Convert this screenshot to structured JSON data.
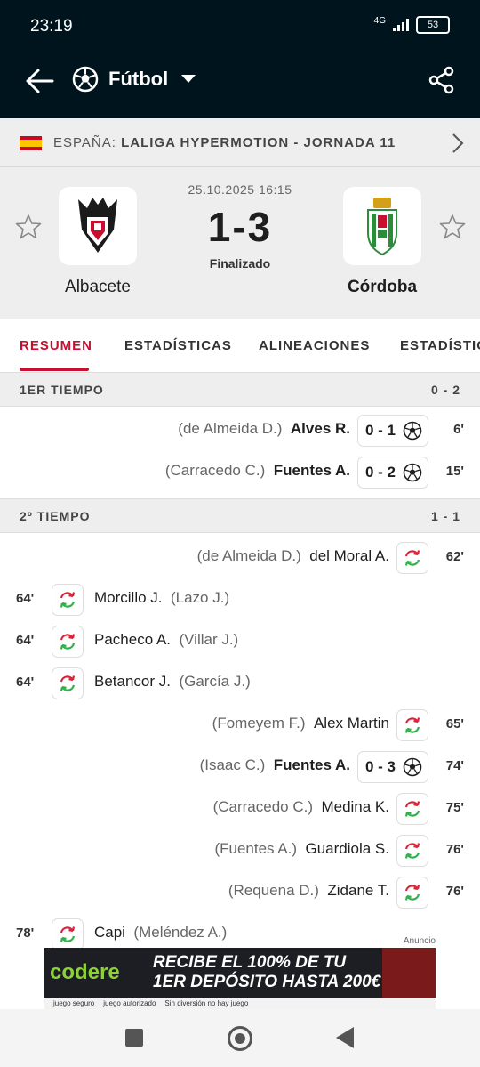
{
  "status_bar": {
    "time": "23:19",
    "network": "4G",
    "battery": "53"
  },
  "app_bar": {
    "title": "Fútbol"
  },
  "league": {
    "country": "ESPAÑA: ",
    "competition": "LALIGA HYPERMOTION - JORNADA 11"
  },
  "match": {
    "date": "25.10.2025 16:15",
    "score": "1-3",
    "status": "Finalizado",
    "home_team": "Albacete",
    "away_team": "Córdoba"
  },
  "tabs": [
    "RESUMEN",
    "ESTADÍSTICAS",
    "ALINEACIONES",
    "ESTADÍSTICAS"
  ],
  "sections": [
    {
      "title": "1ER TIEMPO",
      "score": "0 - 2"
    },
    {
      "title": "2º TIEMPO",
      "score": "1 - 1"
    }
  ],
  "events": [
    {
      "side": "away",
      "type": "goal",
      "minute": "6'",
      "player": "Alves R.",
      "assist": "(de Almeida D.)",
      "score": "0 - 1"
    },
    {
      "side": "away",
      "type": "goal",
      "minute": "15'",
      "player": "Fuentes A.",
      "assist": "(Carracedo C.)",
      "score": "0 - 2"
    },
    {
      "side": "away",
      "type": "sub",
      "minute": "62'",
      "player": "del Moral A.",
      "assist": "(de Almeida D.)"
    },
    {
      "side": "home",
      "type": "sub",
      "minute": "64'",
      "player": "Morcillo J.",
      "assist": "(Lazo J.)"
    },
    {
      "side": "home",
      "type": "sub",
      "minute": "64'",
      "player": "Pacheco A.",
      "assist": "(Villar J.)"
    },
    {
      "side": "home",
      "type": "sub",
      "minute": "64'",
      "player": "Betancor J.",
      "assist": "(García J.)"
    },
    {
      "side": "away",
      "type": "sub",
      "minute": "65'",
      "player": "Alex Martin",
      "assist": "(Fomeyem F.)"
    },
    {
      "side": "away",
      "type": "goal",
      "minute": "74'",
      "player": "Fuentes A.",
      "assist": "(Isaac C.)",
      "score": "0 - 3"
    },
    {
      "side": "away",
      "type": "sub",
      "minute": "75'",
      "player": "Medina K.",
      "assist": "(Carracedo C.)"
    },
    {
      "side": "away",
      "type": "sub",
      "minute": "76'",
      "player": "Guardiola S.",
      "assist": "(Fuentes A.)"
    },
    {
      "side": "away",
      "type": "sub",
      "minute": "76'",
      "player": "Zidane T.",
      "assist": "(Requena D.)"
    },
    {
      "side": "home",
      "type": "sub",
      "minute": "78'",
      "player": "Capi",
      "assist": "(Meléndez A.)"
    }
  ],
  "ad": {
    "label": "Anuncio",
    "brand": "codere",
    "headline_1": "RECIBE EL 100% DE TU",
    "headline_2": "1ER DEPÓSITO HASTA 200€",
    "strip": [
      "juego seguro",
      "juego autorizado",
      "Sin diversión no hay juego"
    ]
  },
  "colors": {
    "header_bg": "#00141e",
    "accent": "#c8102e",
    "sub_green": "#2db34a",
    "sub_red": "#d9253a"
  }
}
